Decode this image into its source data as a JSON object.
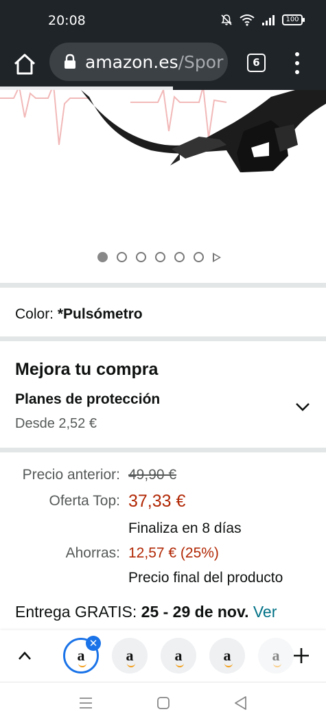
{
  "status_bar": {
    "time": "20:08",
    "battery": "100"
  },
  "browser": {
    "url_domain": "amazon.es",
    "url_path": "/Spor",
    "tab_count": "6",
    "load_progress": 0.53
  },
  "gallery": {
    "image_count": 6,
    "active_index": 0
  },
  "color": {
    "label": "Color:",
    "value": "*Pulsómetro"
  },
  "upgrade": {
    "title": "Mejora tu compra",
    "plans_title": "Planes de protección",
    "plans_price": "Desde 2,52 €"
  },
  "pricing": {
    "previous_label": "Precio anterior:",
    "previous_value": "49,90 €",
    "deal_label": "Oferta Top:",
    "deal_value": "37,33 €",
    "deal_ends": "Finaliza en 8 días",
    "savings_label": "Ahorras:",
    "savings_value": "12,57 € (25%)",
    "final_note": "Precio final del producto"
  },
  "delivery": {
    "prefix": "Entrega GRATIS:",
    "dates": "25 - 29 de nov.",
    "link": "Ver"
  },
  "tab_strip": {
    "close_glyph": "✕",
    "logo_letter": "a"
  },
  "colors": {
    "chrome": "#1f2428",
    "accent": "#1a73e8",
    "price_red": "#b12704",
    "link": "#007185"
  }
}
